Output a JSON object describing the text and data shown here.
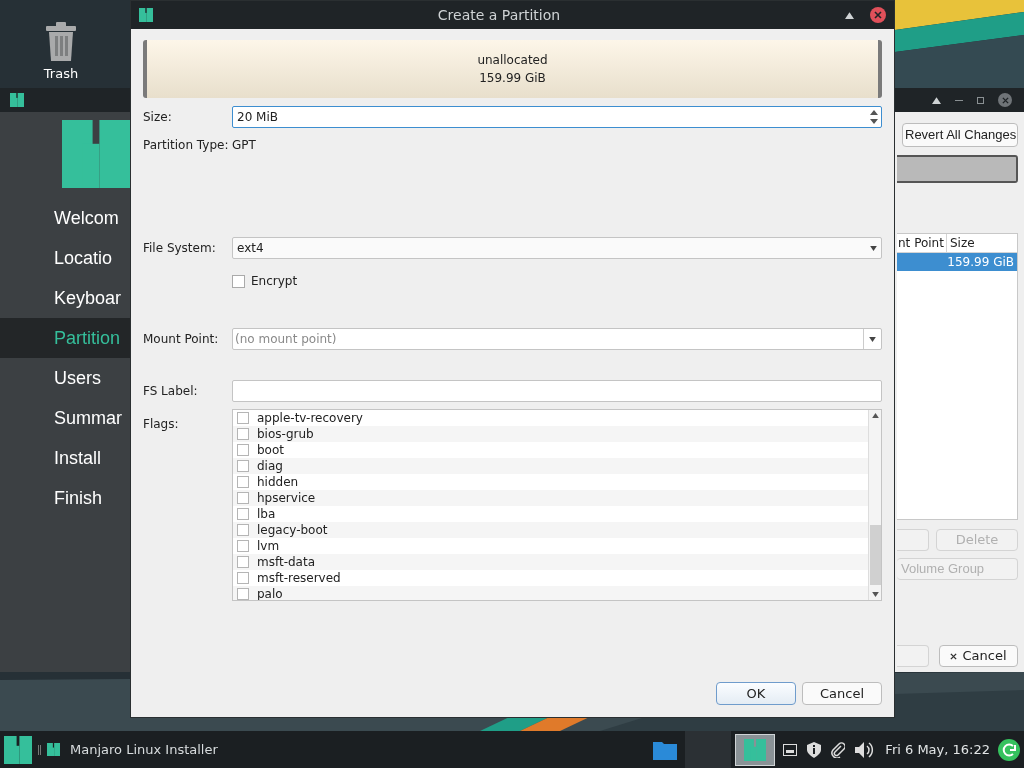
{
  "desktop": {
    "icons": [
      {
        "label": "Trash"
      }
    ]
  },
  "installer": {
    "sidebar": {
      "items": [
        {
          "label": "Welcom",
          "selected": false
        },
        {
          "label": "Locatio",
          "selected": false
        },
        {
          "label": "Keyboar",
          "selected": false
        },
        {
          "label": "Partition",
          "selected": true
        },
        {
          "label": "Users",
          "selected": false
        },
        {
          "label": "Summar",
          "selected": false
        },
        {
          "label": "Install",
          "selected": false
        },
        {
          "label": "Finish",
          "selected": false
        }
      ]
    },
    "revert_button": "Revert All Changes",
    "table": {
      "columns": [
        "nt Point",
        "Size"
      ],
      "rows": [
        {
          "size": "159.99 GiB",
          "selected": true
        }
      ]
    },
    "delete_button": {
      "label": "Delete",
      "disabled": true
    },
    "volume_button": {
      "label": "Volume Group",
      "disabled": true
    },
    "cancel_button": {
      "label": "Cancel",
      "disabled": false
    }
  },
  "dialog": {
    "title": "Create a Partition",
    "partition_bar": {
      "label": "unallocated",
      "size": "159.99 GiB"
    },
    "size": {
      "label": "Size:",
      "value": "20 MiB"
    },
    "partition_type": {
      "label": "Partition Type:",
      "value": "GPT"
    },
    "file_system": {
      "label": "File System:",
      "value": "ext4"
    },
    "encrypt": {
      "label": "Encrypt",
      "checked": false
    },
    "mount_point": {
      "label": "Mount Point:",
      "placeholder": "(no mount point)"
    },
    "fs_label": {
      "label": "FS Label:"
    },
    "flags": {
      "label": "Flags:",
      "items": [
        {
          "label": "apple-tv-recovery",
          "checked": false
        },
        {
          "label": "bios-grub",
          "checked": false
        },
        {
          "label": "boot",
          "checked": false
        },
        {
          "label": "diag",
          "checked": false
        },
        {
          "label": "hidden",
          "checked": false
        },
        {
          "label": "hpservice",
          "checked": false
        },
        {
          "label": "lba",
          "checked": false
        },
        {
          "label": "legacy-boot",
          "checked": false
        },
        {
          "label": "lvm",
          "checked": false
        },
        {
          "label": "msft-data",
          "checked": false
        },
        {
          "label": "msft-reserved",
          "checked": false
        },
        {
          "label": "palo",
          "checked": false
        }
      ]
    },
    "buttons": [
      "OK",
      "Cancel"
    ]
  },
  "taskbar": {
    "window": "Manjaro Linux Installer",
    "clock": "Fri 6 May, 16:22"
  }
}
